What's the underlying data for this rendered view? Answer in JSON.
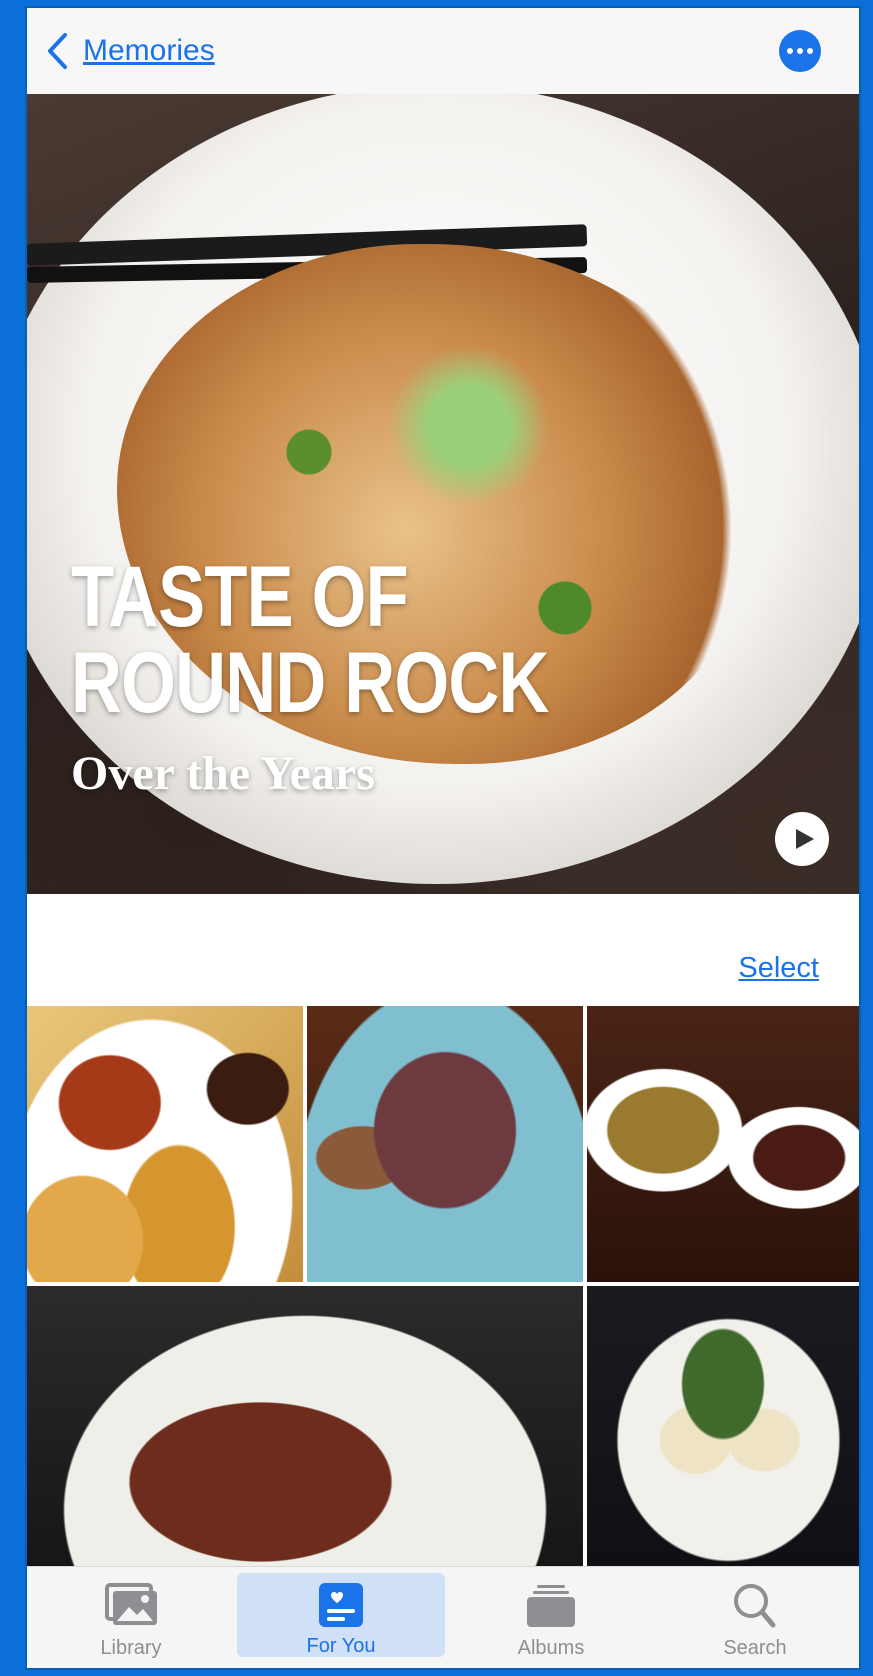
{
  "nav": {
    "back_label": "Memories",
    "more_icon": "ellipsis-icon"
  },
  "hero": {
    "title_line1": "TASTE OF",
    "title_line2": "ROUND ROCK",
    "subtitle": "Over the Years",
    "play_icon": "play-icon"
  },
  "grid": {
    "select_label": "Select",
    "photos": [
      "food-photo",
      "food-photo",
      "food-photo",
      "food-photo",
      "food-photo"
    ]
  },
  "tabbar": {
    "tabs": [
      {
        "label": "Library",
        "icon": "photo-library-icon",
        "active": false
      },
      {
        "label": "For You",
        "icon": "for-you-icon",
        "active": true
      },
      {
        "label": "Albums",
        "icon": "albums-icon",
        "active": false
      },
      {
        "label": "Search",
        "icon": "search-icon",
        "active": false
      }
    ]
  },
  "colors": {
    "accent": "#1a73e8",
    "background": "#0b6fd9",
    "tab_inactive": "#8e8e93"
  }
}
